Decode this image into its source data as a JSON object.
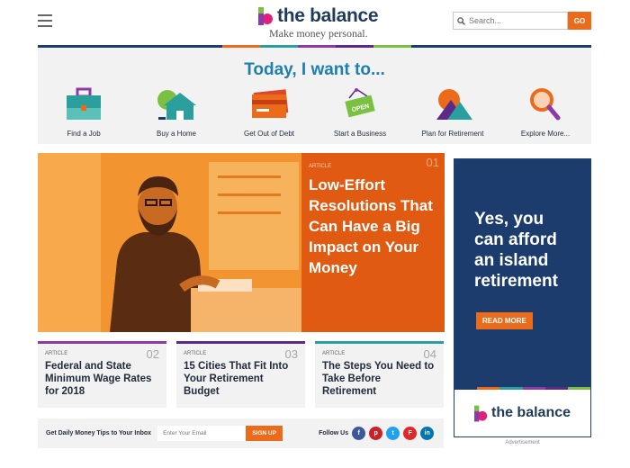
{
  "header": {
    "brand": "the balance",
    "tagline": "Make money personal.",
    "search_placeholder": "Search...",
    "search_button": "GO"
  },
  "colors": {
    "brand_orange": "#ec6b1a",
    "brand_navy": "#1c3c6d",
    "teal": "#2b9e9e",
    "purple": "#8e3aa6",
    "green": "#7ac143",
    "blue_title": "#1e7fae"
  },
  "today": {
    "title": "Today, I want to...",
    "categories": [
      {
        "label": "Find a Job",
        "icon": "briefcase-icon"
      },
      {
        "label": "Buy a Home",
        "icon": "house-icon"
      },
      {
        "label": "Get Out of Debt",
        "icon": "credit-card-icon"
      },
      {
        "label": "Start a Business",
        "icon": "open-sign-icon"
      },
      {
        "label": "Plan for Retirement",
        "icon": "mountain-sun-icon"
      },
      {
        "label": "Explore More...",
        "icon": "magnifier-icon"
      }
    ]
  },
  "hero": {
    "kicker": "ARTICLE",
    "number": "01",
    "headline": "Low-Effort Resolutions That Can Have a Big Impact on Your Money"
  },
  "ad": {
    "headline": "Yes, you can afford an island retirement",
    "button": "READ MORE",
    "brand": "the balance",
    "caption": "Advertisement"
  },
  "cards": [
    {
      "kicker": "ARTICLE",
      "number": "02",
      "title": "Federal and State Minimum Wage Rates for 2018",
      "color": "#8e3aa6"
    },
    {
      "kicker": "ARTICLE",
      "number": "03",
      "title": "15 Cities That Fit Into Your Retirement Budget",
      "color": "#5b2a86"
    },
    {
      "kicker": "ARTICLE",
      "number": "04",
      "title": "The Steps You Need to Take Before Retirement",
      "color": "#2b9e9e"
    }
  ],
  "newsletter": {
    "label": "Get Daily Money Tips to Your Inbox",
    "placeholder": "Enter Your Email",
    "button": "SIGN UP",
    "follow": "Follow Us",
    "social": [
      {
        "icon": "facebook-icon",
        "glyph": "f",
        "color": "#3b5998"
      },
      {
        "icon": "pinterest-icon",
        "glyph": "p",
        "color": "#cb2027"
      },
      {
        "icon": "twitter-icon",
        "glyph": "t",
        "color": "#1da1f2"
      },
      {
        "icon": "flipboard-icon",
        "glyph": "F",
        "color": "#e12828"
      },
      {
        "icon": "linkedin-icon",
        "glyph": "in",
        "color": "#0077b5"
      }
    ]
  }
}
